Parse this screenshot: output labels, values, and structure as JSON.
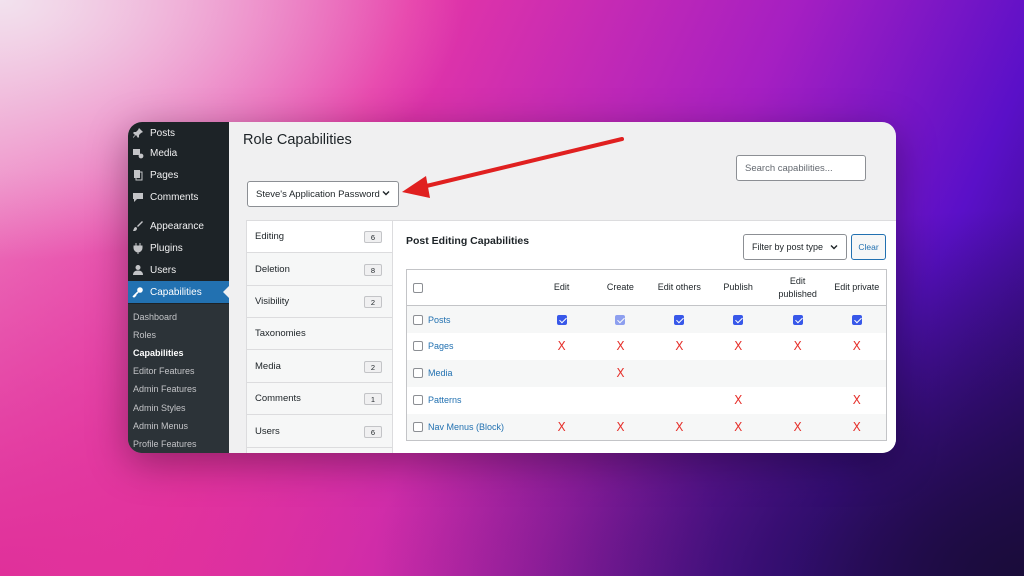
{
  "sidebar": {
    "items": [
      {
        "label": "Posts",
        "icon": "pin-icon"
      },
      {
        "label": "Media",
        "icon": "media-icon"
      },
      {
        "label": "Pages",
        "icon": "pages-icon"
      },
      {
        "label": "Comments",
        "icon": "comment-icon"
      },
      {
        "label": "Appearance",
        "icon": "brush-icon"
      },
      {
        "label": "Plugins",
        "icon": "plug-icon"
      },
      {
        "label": "Users",
        "icon": "user-icon"
      },
      {
        "label": "Capabilities",
        "icon": "key-icon"
      }
    ],
    "submenu": [
      "Dashboard",
      "Roles",
      "Capabilities",
      "Editor Features",
      "Admin Features",
      "Admin Styles",
      "Admin Menus",
      "Profile Features"
    ]
  },
  "page": {
    "title": "Role Capabilities",
    "search_placeholder": "Search capabilities...",
    "role_select": "Steve's Application Password"
  },
  "tabs": [
    {
      "label": "Editing",
      "count": "6"
    },
    {
      "label": "Deletion",
      "count": "8"
    },
    {
      "label": "Visibility",
      "count": "2"
    },
    {
      "label": "Taxonomies",
      "count": ""
    },
    {
      "label": "Media",
      "count": "2"
    },
    {
      "label": "Comments",
      "count": "1"
    },
    {
      "label": "Users",
      "count": "6"
    }
  ],
  "panel": {
    "title": "Post Editing Capabilities",
    "filter_label": "Filter by post type",
    "clear_label": "Clear",
    "columns": [
      "Edit",
      "Create",
      "Edit others",
      "Publish",
      "Edit published",
      "Edit private"
    ],
    "rows": [
      {
        "label": "Posts",
        "cells": [
          "check",
          "check-dim",
          "check",
          "check",
          "check",
          "check"
        ]
      },
      {
        "label": "Pages",
        "cells": [
          "x",
          "x",
          "x",
          "x",
          "x",
          "x"
        ]
      },
      {
        "label": "Media",
        "cells": [
          "",
          "x",
          "",
          "",
          "",
          ""
        ]
      },
      {
        "label": "Patterns",
        "cells": [
          "",
          "",
          "",
          "x",
          "",
          "x"
        ]
      },
      {
        "label": "Nav Menus (Block)",
        "cells": [
          "x",
          "x",
          "x",
          "x",
          "x",
          "x"
        ]
      }
    ],
    "x_symbol": "X"
  },
  "colors": {
    "admin_bar": "#1d2327",
    "accent": "#2271b1",
    "checkbox": "#3858e9",
    "denied": "#e6322d",
    "arrow": "#e02020"
  }
}
